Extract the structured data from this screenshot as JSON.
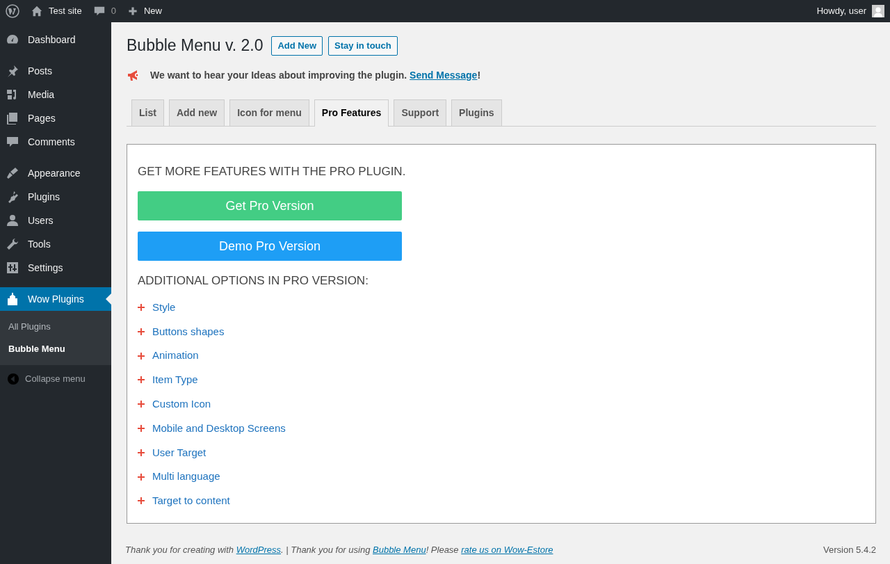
{
  "admin_bar": {
    "site": "Test site",
    "comments_count": "0",
    "new": "New",
    "greeting": "Howdy, user"
  },
  "sidebar": {
    "groups": [
      [
        {
          "label": "Dashboard",
          "selected": false
        }
      ],
      [
        {
          "label": "Posts",
          "selected": false
        },
        {
          "label": "Media",
          "selected": false
        },
        {
          "label": "Pages",
          "selected": false
        },
        {
          "label": "Comments",
          "selected": false
        }
      ],
      [
        {
          "label": "Appearance",
          "selected": false
        },
        {
          "label": "Plugins",
          "selected": false
        },
        {
          "label": "Users",
          "selected": false
        },
        {
          "label": "Tools",
          "selected": false
        },
        {
          "label": "Settings",
          "selected": false
        }
      ],
      [
        {
          "label": "Wow Plugins",
          "selected": true,
          "children": [
            {
              "label": "All Plugins",
              "selected": false
            },
            {
              "label": "Bubble Menu",
              "selected": true
            }
          ]
        }
      ]
    ],
    "collapse": "Collapse menu"
  },
  "page": {
    "title": "Bubble Menu v. 2.0",
    "header_buttons": [
      "Add New",
      "Stay in touch"
    ],
    "notice": [
      {
        "kind": "text",
        "text": "We want to hear your Ideas about improving the plugin. "
      },
      {
        "kind": "link",
        "text": "Send Message"
      },
      {
        "kind": "text",
        "text": "!"
      }
    ],
    "tabs": [
      {
        "label": "List",
        "selected": false
      },
      {
        "label": "Add new",
        "selected": false
      },
      {
        "label": "Icon for menu",
        "selected": false
      },
      {
        "label": "Pro Features",
        "selected": true
      },
      {
        "label": "Support",
        "selected": false
      },
      {
        "label": "Plugins",
        "selected": false
      }
    ],
    "panel": {
      "heading": "GET MORE FEATURES WITH THE PRO PLUGIN.",
      "buttons": [
        {
          "label": "Get Pro Version",
          "color": "#43cd84"
        },
        {
          "label": "Demo Pro Version",
          "color": "#1e9ef5"
        }
      ],
      "options_heading": "ADDITIONAL OPTIONS IN PRO VERSION:",
      "options": [
        "Style",
        "Buttons shapes",
        "Animation",
        "Item Type",
        "Custom Icon",
        "Mobile and Desktop Screens",
        "User Target",
        "Multi language",
        "Target to content"
      ]
    }
  },
  "footer": {
    "text": [
      {
        "kind": "text",
        "text": "Thank you for creating with "
      },
      {
        "kind": "link",
        "text": "WordPress"
      },
      {
        "kind": "text",
        "text": ". | Thank you for using "
      },
      {
        "kind": "link",
        "text": "Bubble Menu"
      },
      {
        "kind": "text",
        "text": "! Please "
      },
      {
        "kind": "link",
        "text": "rate us on Wow-Estore"
      }
    ],
    "version": "Version 5.4.2"
  }
}
